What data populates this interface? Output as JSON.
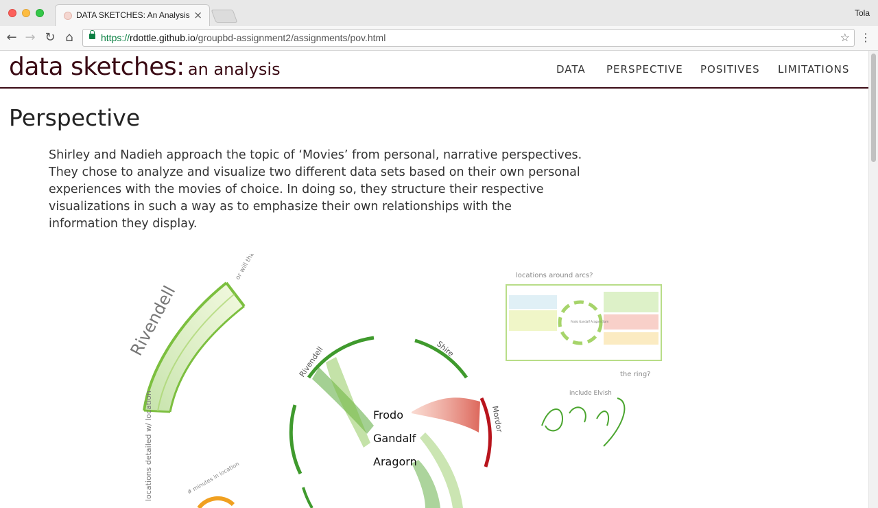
{
  "browser": {
    "tab_title": "DATA SKETCHES: An Analysis",
    "tab_close": "×",
    "profile_name": "Tola",
    "url_protocol": "https://",
    "url_host": "rdottle.github.io",
    "url_path": "/groupbd-assignment2/assignments/pov.html",
    "icons": {
      "back": "←",
      "forward": "→",
      "reload": "↻",
      "home": "⌂",
      "star": "☆",
      "menu": "⋮"
    }
  },
  "site": {
    "brand_main": "data sketches:",
    "brand_sub": "an analysis",
    "nav": [
      "DATA",
      "PERSPECTIVE",
      "POSITIVES",
      "LIMITATIONS"
    ]
  },
  "content": {
    "heading": "Perspective",
    "paragraph": "Shirley and Nadieh approach the topic of ‘Movies’ from personal, narrative perspectives. They chose to analyze and visualize two different data sets based on their own personal experiences with the movies of choice. In doing so, they structure their respective visualizations in such a way as to emphasize their own relationships with the information they display."
  },
  "sketch": {
    "labels": {
      "rivendell_arc": "Rivendell",
      "note_bring_trees": "or will that bring too many trees?",
      "locations_detailed": "locations detailed w/ location",
      "rivendell_circle": "Rivendell",
      "shire": "Shire",
      "mordor": "Mordor",
      "frodo": "Frodo",
      "gandalf": "Gandalf",
      "aragorn": "Aragorn",
      "locations_around_arcs": "locations around arcs?",
      "the_ring": "the ring?",
      "include_elvish": "include Elvish",
      "minutes_in_location": "# minutes in location",
      "arc_center_names": "Frodo Gandalf Aragorn Sam"
    },
    "colors": {
      "green": "#3f9a2d",
      "light_green": "#b9d98a",
      "red": "#b8141c",
      "salmon": "#e8826e",
      "orange": "#f0a020"
    }
  }
}
